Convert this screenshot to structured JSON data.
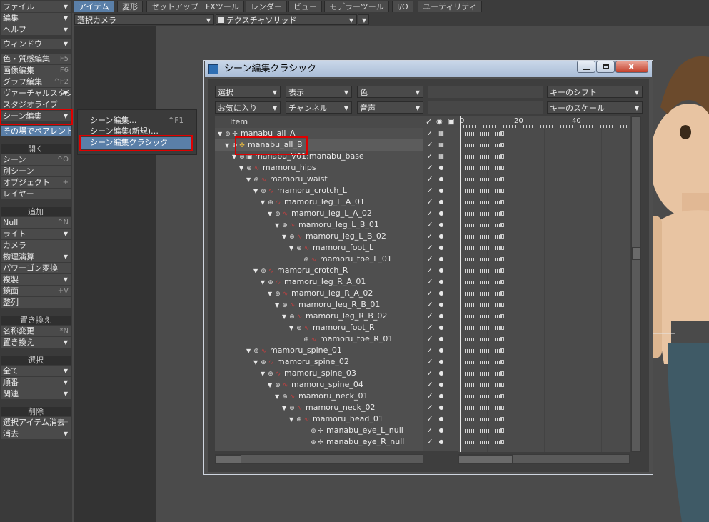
{
  "top_tabs": [
    "アイテム",
    "変形",
    "セットアップ",
    "FXツール",
    "レンダー",
    "ビュー",
    "モデラーツール",
    "I/O",
    "ユーティリティ"
  ],
  "left_menu": {
    "file": "ファイル",
    "edit": "編集",
    "help": "ヘルプ",
    "window": "ウィンドウ",
    "surface_editor": "色・質感編集",
    "surface_editor_key": "F5",
    "image_editor": "画像編集",
    "image_editor_key": "F6",
    "graph_editor": "グラフ編集",
    "graph_editor_key": "^F2",
    "virtual_studio": "ヴァーチャルスタジオ",
    "studio_live": "スタジオライブ",
    "scene_editor": "シーン編集",
    "in_place_preview": "その場でペアレント",
    "open_head": "開く",
    "scene": "シーン",
    "scene_key": "^O",
    "other_scene": "別シーン",
    "object": "オブジェクト",
    "object_key": "+",
    "layer": "レイヤー",
    "add_head": "追加",
    "null": "Null",
    "null_key": "^N",
    "light": "ライト",
    "camera": "カメラ",
    "dynamics": "物理演算",
    "polygon_convert": "パワーゴン変換",
    "clone": "複製",
    "mirror": "鏡面",
    "mirror_key": "+V",
    "align": "整列",
    "replace_head": "置き換え",
    "rename": "名称変更",
    "rename_key": "*N",
    "replace": "置き換え",
    "select_head": "選択",
    "all": "全て",
    "order": "順番",
    "related": "関連",
    "delete_head": "削除",
    "clear_selected": "選択アイテム消去",
    "clear_selected_key": "−",
    "clear": "消去"
  },
  "subbar": {
    "camera_select": "選択カメラ",
    "view_mode": "テクスチャソリッド"
  },
  "submenu": {
    "items": [
      "シーン編集…",
      "シーン編集(新規)…",
      "シーン編集クラシック"
    ],
    "shortcut": "^F1"
  },
  "window": {
    "title": "シーン編集クラシック",
    "controls": {
      "select": "選択",
      "display": "表示",
      "color": "色",
      "key_shift": "キーのシフト",
      "favorites": "お気に入り",
      "channel": "チャンネル",
      "audio": "音声",
      "key_scale": "キーのスケール"
    },
    "column_header": "Item",
    "timeline_ticks": [
      "0",
      "20",
      "40"
    ],
    "rows": [
      {
        "name": "manabu_all_A",
        "depth": 0,
        "type": "null"
      },
      {
        "name": "manabu_all_B",
        "depth": 1,
        "type": "null",
        "selected": true
      },
      {
        "name": "manabu_V01:manabu_base",
        "depth": 2,
        "type": "object"
      },
      {
        "name": "mamoru_hips",
        "depth": 3,
        "type": "bone"
      },
      {
        "name": "mamoru_waist",
        "depth": 4,
        "type": "bone"
      },
      {
        "name": "mamoru_crotch_L",
        "depth": 5,
        "type": "bone"
      },
      {
        "name": "mamoru_leg_L_A_01",
        "depth": 6,
        "type": "bone"
      },
      {
        "name": "mamoru_leg_L_A_02",
        "depth": 7,
        "type": "bone"
      },
      {
        "name": "mamoru_leg_L_B_01",
        "depth": 8,
        "type": "bone"
      },
      {
        "name": "mamoru_leg_L_B_02",
        "depth": 9,
        "type": "bone"
      },
      {
        "name": "mamoru_foot_L",
        "depth": 10,
        "type": "bone"
      },
      {
        "name": "mamoru_toe_L_01",
        "depth": 11,
        "type": "bone"
      },
      {
        "name": "mamoru_crotch_R",
        "depth": 5,
        "type": "bone"
      },
      {
        "name": "mamoru_leg_R_A_01",
        "depth": 6,
        "type": "bone"
      },
      {
        "name": "mamoru_leg_R_A_02",
        "depth": 7,
        "type": "bone"
      },
      {
        "name": "mamoru_leg_R_B_01",
        "depth": 8,
        "type": "bone"
      },
      {
        "name": "mamoru_leg_R_B_02",
        "depth": 9,
        "type": "bone"
      },
      {
        "name": "mamoru_foot_R",
        "depth": 10,
        "type": "bone"
      },
      {
        "name": "mamoru_toe_R_01",
        "depth": 11,
        "type": "bone"
      },
      {
        "name": "mamoru_spine_01",
        "depth": 4,
        "type": "bone"
      },
      {
        "name": "mamoru_spine_02",
        "depth": 5,
        "type": "bone"
      },
      {
        "name": "mamoru_spine_03",
        "depth": 6,
        "type": "bone"
      },
      {
        "name": "mamoru_spine_04",
        "depth": 7,
        "type": "bone"
      },
      {
        "name": "mamoru_neck_01",
        "depth": 8,
        "type": "bone"
      },
      {
        "name": "mamoru_neck_02",
        "depth": 9,
        "type": "bone"
      },
      {
        "name": "mamoru_head_01",
        "depth": 10,
        "type": "bone"
      },
      {
        "name": "manabu_eye_L_null",
        "depth": 12,
        "type": "null"
      },
      {
        "name": "manabu_eye_R_null",
        "depth": 12,
        "type": "null"
      }
    ]
  },
  "colors": {
    "accent": "#5a7fa8",
    "highlight_red": "#e00000",
    "panel_bg": "#3e3e3e"
  }
}
